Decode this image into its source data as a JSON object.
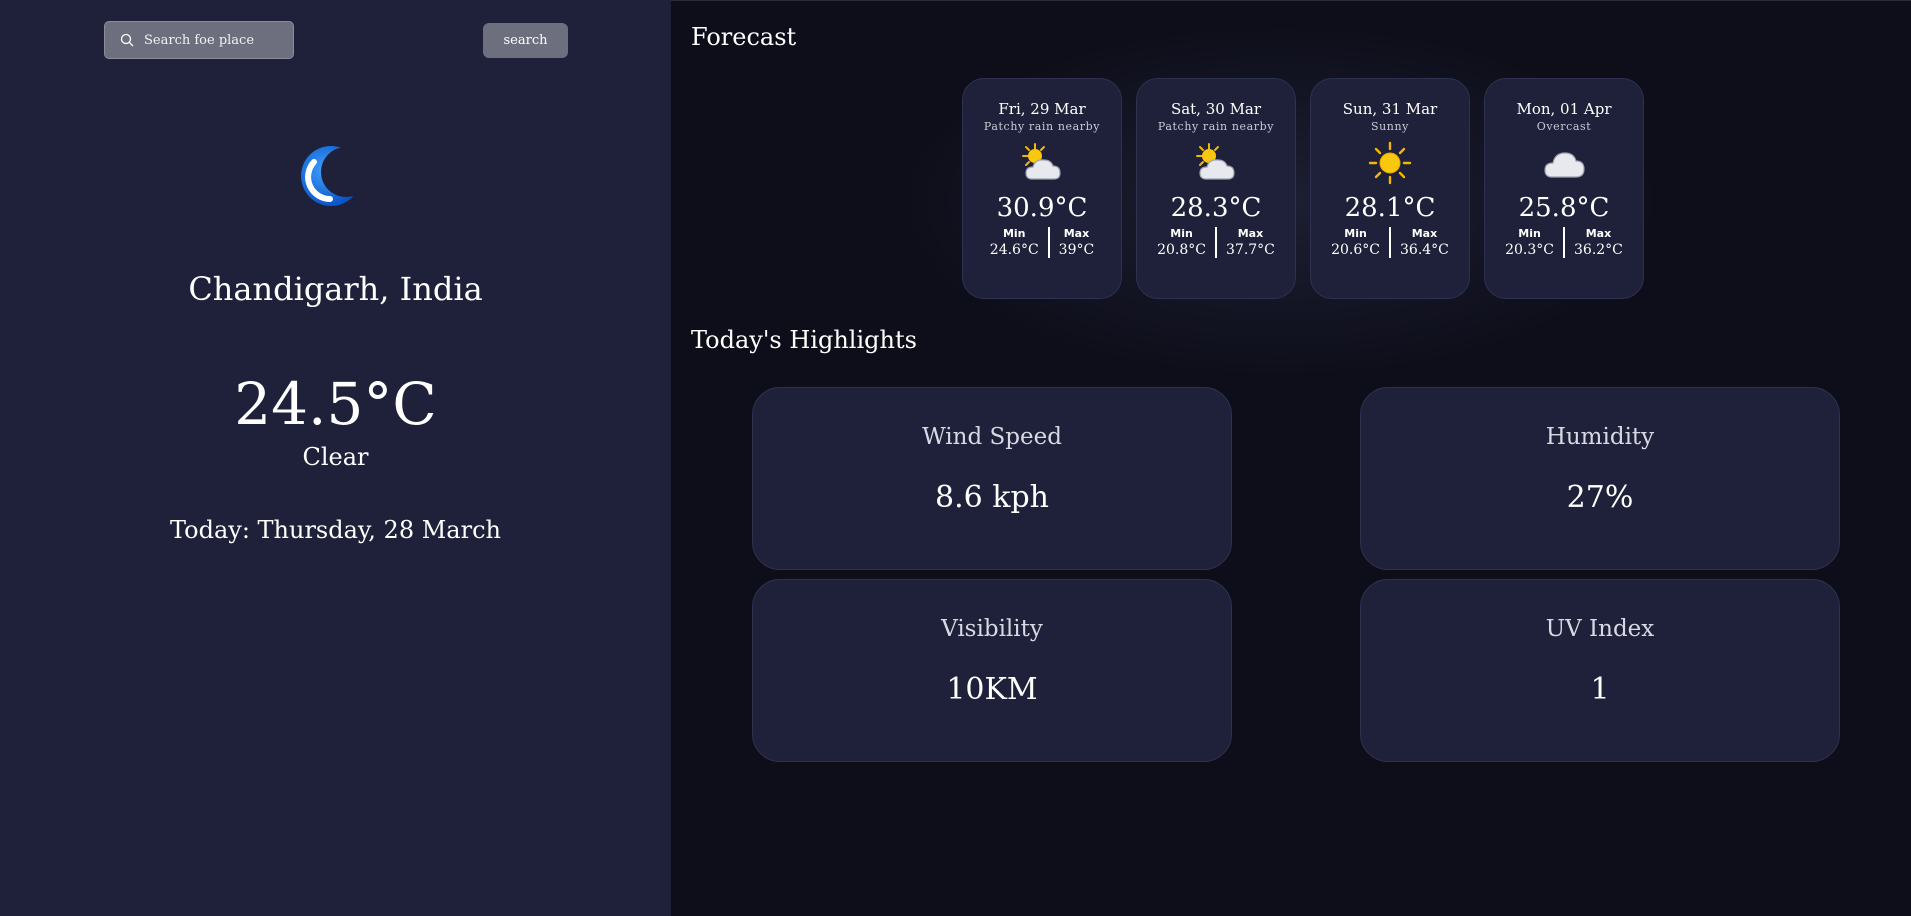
{
  "search": {
    "placeholder": "Search foe place",
    "button_label": "search"
  },
  "current": {
    "icon": "crescent-moon-icon",
    "location": "Chandigarh, India",
    "temperature": "24.5°C",
    "condition": "Clear",
    "date_label": "Today: Thursday, 28 March"
  },
  "forecast": {
    "title": "Forecast",
    "days": [
      {
        "date": "Fri, 29 Mar",
        "condition": "Patchy rain nearby",
        "icon": "sun-behind-cloud-icon",
        "temp": "30.9°C",
        "min_label": "Min",
        "max_label": "Max",
        "min": "24.6°C",
        "max": "39°C"
      },
      {
        "date": "Sat, 30 Mar",
        "condition": "Patchy rain nearby",
        "icon": "sun-behind-cloud-icon",
        "temp": "28.3°C",
        "min_label": "Min",
        "max_label": "Max",
        "min": "20.8°C",
        "max": "37.7°C"
      },
      {
        "date": "Sun, 31 Mar",
        "condition": "Sunny",
        "icon": "sun-icon",
        "temp": "28.1°C",
        "min_label": "Min",
        "max_label": "Max",
        "min": "20.6°C",
        "max": "36.4°C"
      },
      {
        "date": "Mon, 01 Apr",
        "condition": "Overcast",
        "icon": "cloud-icon",
        "temp": "25.8°C",
        "min_label": "Min",
        "max_label": "Max",
        "min": "20.3°C",
        "max": "36.2°C"
      }
    ]
  },
  "highlights": {
    "title": "Today's Highlights",
    "items": [
      {
        "label": "Wind Speed",
        "value": "8.6 kph"
      },
      {
        "label": "Humidity",
        "value": "27%"
      },
      {
        "label": "Visibility",
        "value": "10KM"
      },
      {
        "label": "UV Index",
        "value": "1"
      }
    ]
  },
  "colors": {
    "sidebar_bg": "#1e2139",
    "main_bg": "#0e0e1a",
    "card_bg": "#1e2139",
    "input_bg": "#6e6f7e"
  }
}
